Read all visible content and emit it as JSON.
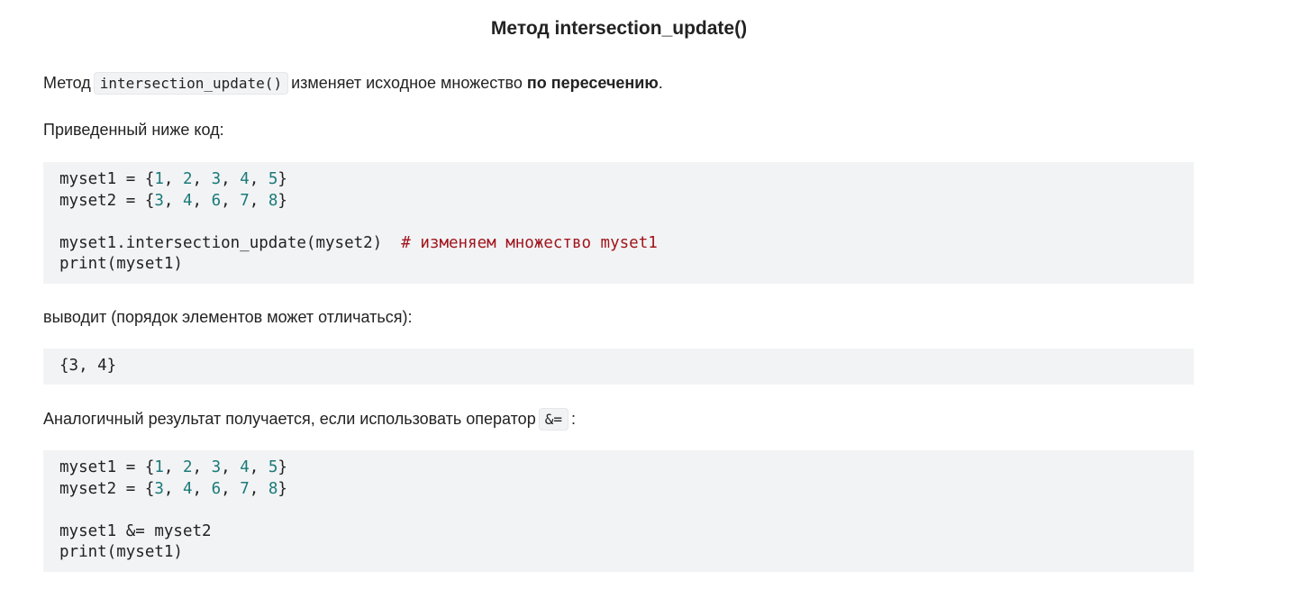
{
  "title": "Метод intersection_update()",
  "p1": {
    "pre": "Метод",
    "code": "intersection_update()",
    "mid": "изменяет исходное множество",
    "bold": "по пересечению",
    "end": "."
  },
  "p2": "Приведенный ниже код:",
  "code1": [
    [
      {
        "t": "myset1 = {"
      },
      {
        "t": "1",
        "k": "n"
      },
      {
        "t": ", "
      },
      {
        "t": "2",
        "k": "n"
      },
      {
        "t": ", "
      },
      {
        "t": "3",
        "k": "n"
      },
      {
        "t": ", "
      },
      {
        "t": "4",
        "k": "n"
      },
      {
        "t": ", "
      },
      {
        "t": "5",
        "k": "n"
      },
      {
        "t": "}"
      }
    ],
    [
      {
        "t": "myset2 = {"
      },
      {
        "t": "3",
        "k": "n"
      },
      {
        "t": ", "
      },
      {
        "t": "4",
        "k": "n"
      },
      {
        "t": ", "
      },
      {
        "t": "6",
        "k": "n"
      },
      {
        "t": ", "
      },
      {
        "t": "7",
        "k": "n"
      },
      {
        "t": ", "
      },
      {
        "t": "8",
        "k": "n"
      },
      {
        "t": "}"
      }
    ],
    [],
    [
      {
        "t": "myset1.intersection_update(myset2)  "
      },
      {
        "t": "# изменяем множество myset1",
        "k": "c"
      }
    ],
    [
      {
        "t": "print(myset1)"
      }
    ]
  ],
  "p3": "выводит (порядок элементов может отличаться):",
  "output": [
    [
      {
        "t": "{3, 4}"
      }
    ]
  ],
  "p4": {
    "pre": "Аналогичный результат получается, если использовать оператор",
    "code": "&=",
    "end": ":"
  },
  "code2": [
    [
      {
        "t": "myset1 = {"
      },
      {
        "t": "1",
        "k": "n"
      },
      {
        "t": ", "
      },
      {
        "t": "2",
        "k": "n"
      },
      {
        "t": ", "
      },
      {
        "t": "3",
        "k": "n"
      },
      {
        "t": ", "
      },
      {
        "t": "4",
        "k": "n"
      },
      {
        "t": ", "
      },
      {
        "t": "5",
        "k": "n"
      },
      {
        "t": "}"
      }
    ],
    [
      {
        "t": "myset2 = {"
      },
      {
        "t": "3",
        "k": "n"
      },
      {
        "t": ", "
      },
      {
        "t": "4",
        "k": "n"
      },
      {
        "t": ", "
      },
      {
        "t": "6",
        "k": "n"
      },
      {
        "t": ", "
      },
      {
        "t": "7",
        "k": "n"
      },
      {
        "t": ", "
      },
      {
        "t": "8",
        "k": "n"
      },
      {
        "t": "}"
      }
    ],
    [],
    [
      {
        "t": "myset1 &= myset2"
      }
    ],
    [
      {
        "t": "print(myset1)"
      }
    ]
  ]
}
